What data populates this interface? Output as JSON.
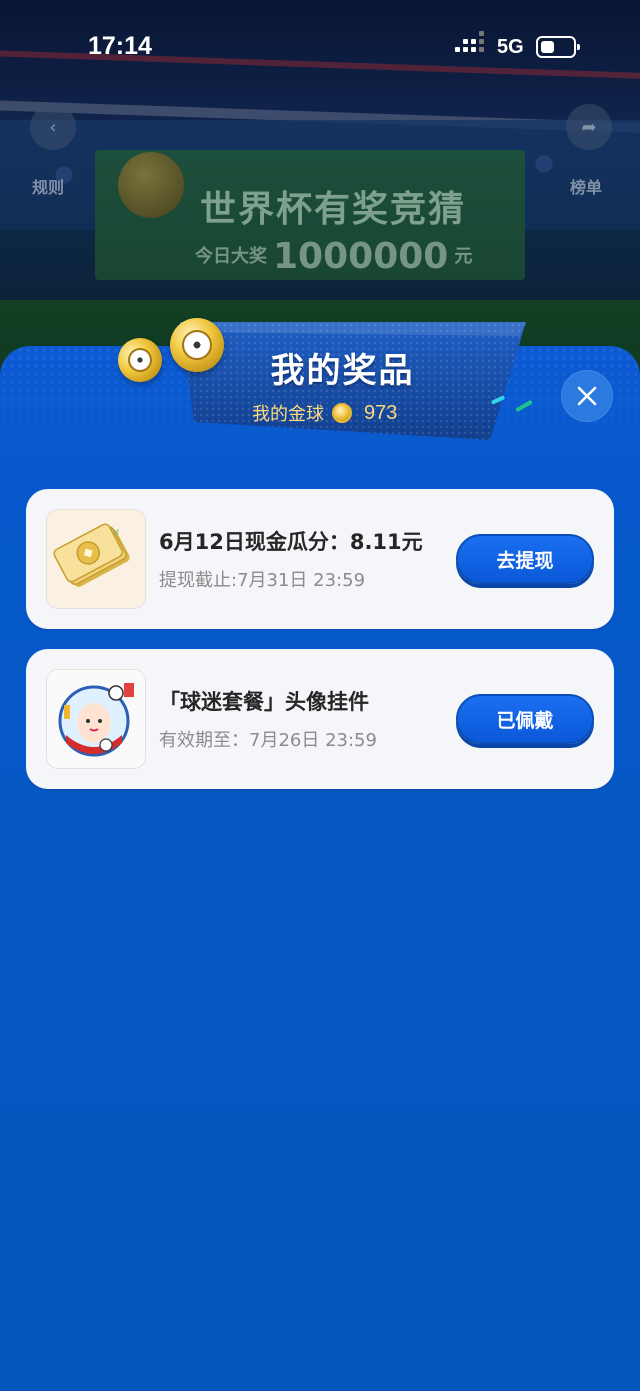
{
  "status_bar": {
    "time": "17:14",
    "network": "5G"
  },
  "background": {
    "banner_title": "世界杯有奖竞猜",
    "banner_prefix": "今日大奖",
    "banner_amount": "1000000",
    "banner_unit": "元",
    "left_label": "规则",
    "right_label": "榜单"
  },
  "panel": {
    "title": "我的奖品",
    "balance_label": "我的金球",
    "balance_value": "973"
  },
  "prizes": [
    {
      "title": "6月12日现金瓜分：8.11元",
      "subtitle": "提现截止:7月31日 23:59",
      "action": "去提现",
      "icon": "cash-icon"
    },
    {
      "title": "「球迷套餐」头像挂件",
      "subtitle": "有效期至：7月26日 23:59",
      "action": "已佩戴",
      "icon": "avatar-pendant-icon"
    }
  ],
  "colors": {
    "panel_blue": "#0558c8",
    "button_blue": "#0a59d9",
    "card_bg": "#f4f6f9",
    "gold": "#f1c83f"
  }
}
